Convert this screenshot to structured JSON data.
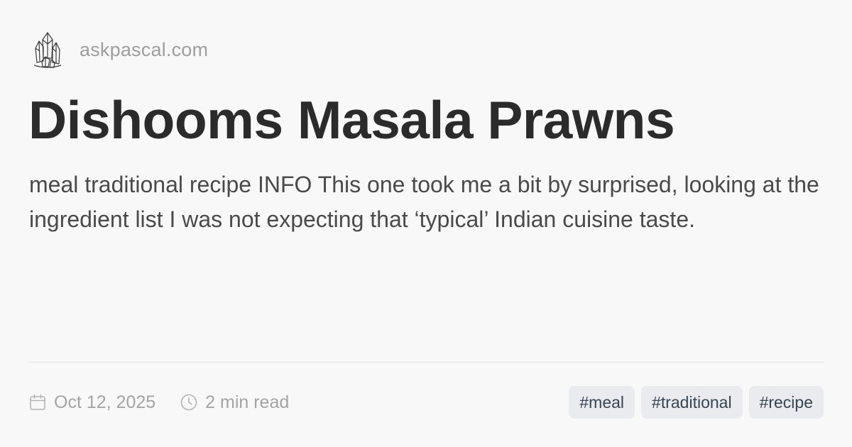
{
  "site": {
    "domain": "askpascal.com",
    "logo_icon": "crystal-cluster-icon"
  },
  "article": {
    "title": "Dishooms Masala Prawns",
    "description": "meal traditional recipe INFO This one took me a bit by surprised, looking at the ingredient list I was not expecting that ‘typical’ Indian cuisine taste.",
    "date": "Oct 12, 2025",
    "date_icon": "calendar-icon",
    "read_time": "2 min read",
    "read_time_icon": "clock-icon",
    "tags": [
      "#meal",
      "#traditional",
      "#recipe"
    ]
  },
  "colors": {
    "background": "#f9f8f9",
    "title": "#2b2b2b",
    "description": "#4a4a4a",
    "muted": "#a4a4a4",
    "tag_background": "#eaebee",
    "tag_text": "#384552"
  }
}
